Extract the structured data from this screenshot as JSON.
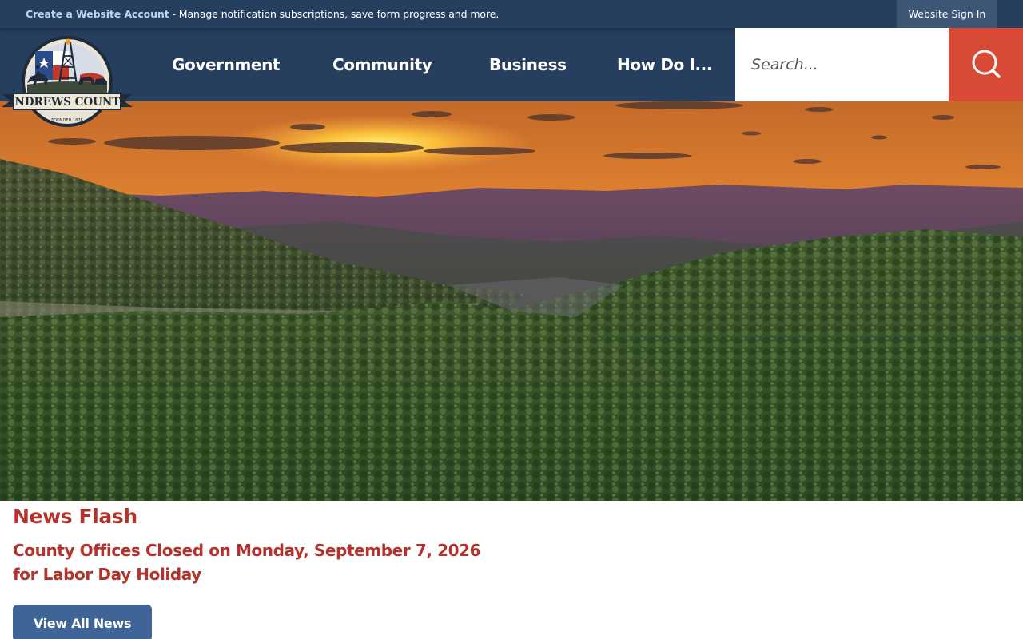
{
  "topbar": {
    "account_link": "Create a Website Account",
    "account_desc": " - Manage notification subscriptions, save form progress and more.",
    "signin": "Website Sign In"
  },
  "logo": {
    "text": "ANDREWS COUNTY",
    "founded": "FOUNDED 1876"
  },
  "nav": {
    "items": [
      {
        "label": "Government"
      },
      {
        "label": "Community"
      },
      {
        "label": "Business"
      },
      {
        "label": "How Do I..."
      }
    ]
  },
  "search": {
    "placeholder": "Search...",
    "icon": "search-icon"
  },
  "news": {
    "title": "News Flash",
    "headline": "County Offices Closed on Monday, September 7, 2026 for Labor Day Holiday",
    "view_all": "View All News"
  },
  "colors": {
    "navy": "#263f5f",
    "accent_red": "#d94a36",
    "news_red": "#b4322c",
    "button_blue": "#3f6497"
  }
}
